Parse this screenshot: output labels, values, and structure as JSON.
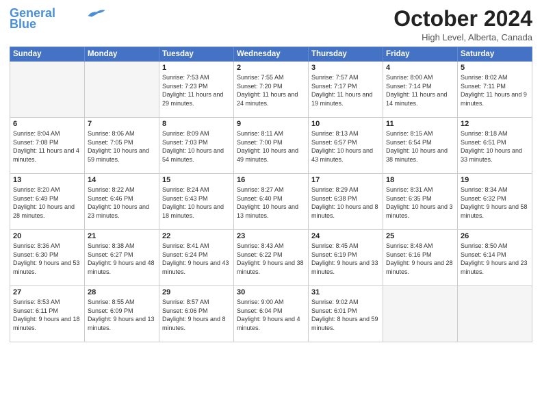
{
  "header": {
    "logo_line1": "General",
    "logo_line2": "Blue",
    "month_title": "October 2024",
    "location": "High Level, Alberta, Canada"
  },
  "weekdays": [
    "Sunday",
    "Monday",
    "Tuesday",
    "Wednesday",
    "Thursday",
    "Friday",
    "Saturday"
  ],
  "weeks": [
    [
      {
        "day": "",
        "sunrise": "",
        "sunset": "",
        "daylight": "",
        "empty": true
      },
      {
        "day": "",
        "sunrise": "",
        "sunset": "",
        "daylight": "",
        "empty": true
      },
      {
        "day": "1",
        "sunrise": "Sunrise: 7:53 AM",
        "sunset": "Sunset: 7:23 PM",
        "daylight": "Daylight: 11 hours and 29 minutes."
      },
      {
        "day": "2",
        "sunrise": "Sunrise: 7:55 AM",
        "sunset": "Sunset: 7:20 PM",
        "daylight": "Daylight: 11 hours and 24 minutes."
      },
      {
        "day": "3",
        "sunrise": "Sunrise: 7:57 AM",
        "sunset": "Sunset: 7:17 PM",
        "daylight": "Daylight: 11 hours and 19 minutes."
      },
      {
        "day": "4",
        "sunrise": "Sunrise: 8:00 AM",
        "sunset": "Sunset: 7:14 PM",
        "daylight": "Daylight: 11 hours and 14 minutes."
      },
      {
        "day": "5",
        "sunrise": "Sunrise: 8:02 AM",
        "sunset": "Sunset: 7:11 PM",
        "daylight": "Daylight: 11 hours and 9 minutes."
      }
    ],
    [
      {
        "day": "6",
        "sunrise": "Sunrise: 8:04 AM",
        "sunset": "Sunset: 7:08 PM",
        "daylight": "Daylight: 11 hours and 4 minutes."
      },
      {
        "day": "7",
        "sunrise": "Sunrise: 8:06 AM",
        "sunset": "Sunset: 7:05 PM",
        "daylight": "Daylight: 10 hours and 59 minutes."
      },
      {
        "day": "8",
        "sunrise": "Sunrise: 8:09 AM",
        "sunset": "Sunset: 7:03 PM",
        "daylight": "Daylight: 10 hours and 54 minutes."
      },
      {
        "day": "9",
        "sunrise": "Sunrise: 8:11 AM",
        "sunset": "Sunset: 7:00 PM",
        "daylight": "Daylight: 10 hours and 49 minutes."
      },
      {
        "day": "10",
        "sunrise": "Sunrise: 8:13 AM",
        "sunset": "Sunset: 6:57 PM",
        "daylight": "Daylight: 10 hours and 43 minutes."
      },
      {
        "day": "11",
        "sunrise": "Sunrise: 8:15 AM",
        "sunset": "Sunset: 6:54 PM",
        "daylight": "Daylight: 10 hours and 38 minutes."
      },
      {
        "day": "12",
        "sunrise": "Sunrise: 8:18 AM",
        "sunset": "Sunset: 6:51 PM",
        "daylight": "Daylight: 10 hours and 33 minutes."
      }
    ],
    [
      {
        "day": "13",
        "sunrise": "Sunrise: 8:20 AM",
        "sunset": "Sunset: 6:49 PM",
        "daylight": "Daylight: 10 hours and 28 minutes."
      },
      {
        "day": "14",
        "sunrise": "Sunrise: 8:22 AM",
        "sunset": "Sunset: 6:46 PM",
        "daylight": "Daylight: 10 hours and 23 minutes."
      },
      {
        "day": "15",
        "sunrise": "Sunrise: 8:24 AM",
        "sunset": "Sunset: 6:43 PM",
        "daylight": "Daylight: 10 hours and 18 minutes."
      },
      {
        "day": "16",
        "sunrise": "Sunrise: 8:27 AM",
        "sunset": "Sunset: 6:40 PM",
        "daylight": "Daylight: 10 hours and 13 minutes."
      },
      {
        "day": "17",
        "sunrise": "Sunrise: 8:29 AM",
        "sunset": "Sunset: 6:38 PM",
        "daylight": "Daylight: 10 hours and 8 minutes."
      },
      {
        "day": "18",
        "sunrise": "Sunrise: 8:31 AM",
        "sunset": "Sunset: 6:35 PM",
        "daylight": "Daylight: 10 hours and 3 minutes."
      },
      {
        "day": "19",
        "sunrise": "Sunrise: 8:34 AM",
        "sunset": "Sunset: 6:32 PM",
        "daylight": "Daylight: 9 hours and 58 minutes."
      }
    ],
    [
      {
        "day": "20",
        "sunrise": "Sunrise: 8:36 AM",
        "sunset": "Sunset: 6:30 PM",
        "daylight": "Daylight: 9 hours and 53 minutes."
      },
      {
        "day": "21",
        "sunrise": "Sunrise: 8:38 AM",
        "sunset": "Sunset: 6:27 PM",
        "daylight": "Daylight: 9 hours and 48 minutes."
      },
      {
        "day": "22",
        "sunrise": "Sunrise: 8:41 AM",
        "sunset": "Sunset: 6:24 PM",
        "daylight": "Daylight: 9 hours and 43 minutes."
      },
      {
        "day": "23",
        "sunrise": "Sunrise: 8:43 AM",
        "sunset": "Sunset: 6:22 PM",
        "daylight": "Daylight: 9 hours and 38 minutes."
      },
      {
        "day": "24",
        "sunrise": "Sunrise: 8:45 AM",
        "sunset": "Sunset: 6:19 PM",
        "daylight": "Daylight: 9 hours and 33 minutes."
      },
      {
        "day": "25",
        "sunrise": "Sunrise: 8:48 AM",
        "sunset": "Sunset: 6:16 PM",
        "daylight": "Daylight: 9 hours and 28 minutes."
      },
      {
        "day": "26",
        "sunrise": "Sunrise: 8:50 AM",
        "sunset": "Sunset: 6:14 PM",
        "daylight": "Daylight: 9 hours and 23 minutes."
      }
    ],
    [
      {
        "day": "27",
        "sunrise": "Sunrise: 8:53 AM",
        "sunset": "Sunset: 6:11 PM",
        "daylight": "Daylight: 9 hours and 18 minutes."
      },
      {
        "day": "28",
        "sunrise": "Sunrise: 8:55 AM",
        "sunset": "Sunset: 6:09 PM",
        "daylight": "Daylight: 9 hours and 13 minutes."
      },
      {
        "day": "29",
        "sunrise": "Sunrise: 8:57 AM",
        "sunset": "Sunset: 6:06 PM",
        "daylight": "Daylight: 9 hours and 8 minutes."
      },
      {
        "day": "30",
        "sunrise": "Sunrise: 9:00 AM",
        "sunset": "Sunset: 6:04 PM",
        "daylight": "Daylight: 9 hours and 4 minutes."
      },
      {
        "day": "31",
        "sunrise": "Sunrise: 9:02 AM",
        "sunset": "Sunset: 6:01 PM",
        "daylight": "Daylight: 8 hours and 59 minutes."
      },
      {
        "day": "",
        "sunrise": "",
        "sunset": "",
        "daylight": "",
        "empty": true
      },
      {
        "day": "",
        "sunrise": "",
        "sunset": "",
        "daylight": "",
        "empty": true
      }
    ]
  ]
}
